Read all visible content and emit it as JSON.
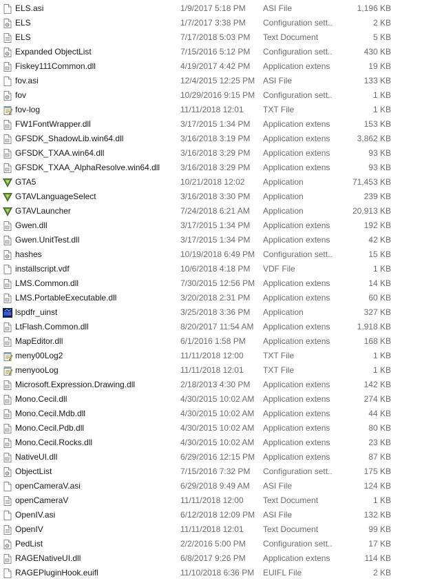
{
  "files": [
    {
      "name": "ELS.asi",
      "date": "1/9/2017 5:18 PM",
      "type": "ASI File",
      "size": "1,196 KB",
      "icon": "generic-file-icon"
    },
    {
      "name": "ELS",
      "date": "1/7/2017 3:38 PM",
      "type": "Configuration sett...",
      "size": "2 KB",
      "icon": "settings-file-icon"
    },
    {
      "name": "ELS",
      "date": "7/17/2018 5:03 PM",
      "type": "Text Document",
      "size": "5 KB",
      "icon": "text-file-icon"
    },
    {
      "name": "Expanded ObjectList",
      "date": "7/15/2016 5:12 PM",
      "type": "Configuration sett...",
      "size": "430 KB",
      "icon": "settings-file-icon"
    },
    {
      "name": "Fiskey111Common.dll",
      "date": "4/19/2017 4:42 PM",
      "type": "Application extens",
      "size": "19 KB",
      "icon": "dll-file-icon"
    },
    {
      "name": "fov.asi",
      "date": "12/4/2015 12:25 PM",
      "type": "ASI File",
      "size": "133 KB",
      "icon": "generic-file-icon"
    },
    {
      "name": "fov",
      "date": "10/29/2016 9:15 PM",
      "type": "Configuration sett...",
      "size": "1 KB",
      "icon": "settings-file-icon"
    },
    {
      "name": "fov-log",
      "date": "11/11/2018 12:01",
      "type": "TXT File",
      "size": "1 KB",
      "icon": "notepad-file-icon"
    },
    {
      "name": "FW1FontWrapper.dll",
      "date": "3/17/2015 1:34 PM",
      "type": "Application extens",
      "size": "153 KB",
      "icon": "dll-file-icon"
    },
    {
      "name": "GFSDK_ShadowLib.win64.dll",
      "date": "3/16/2018 3:19 PM",
      "type": "Application extens",
      "size": "3,862 KB",
      "icon": "dll-file-icon"
    },
    {
      "name": "GFSDK_TXAA.win64.dll",
      "date": "3/16/2018 3:29 PM",
      "type": "Application extens",
      "size": "93 KB",
      "icon": "dll-file-icon"
    },
    {
      "name": "GFSDK_TXAA_AlphaResolve.win64.dll",
      "date": "3/16/2018 3:29 PM",
      "type": "Application extens",
      "size": "93 KB",
      "icon": "dll-file-icon"
    },
    {
      "name": "GTA5",
      "date": "10/21/2018 12:02",
      "type": "Application",
      "size": "71,453 KB",
      "icon": "gta-v-icon"
    },
    {
      "name": "GTAVLanguageSelect",
      "date": "3/16/2018 3:30 PM",
      "type": "Application",
      "size": "239 KB",
      "icon": "gta-v-icon"
    },
    {
      "name": "GTAVLauncher",
      "date": "7/24/2018 6:21 AM",
      "type": "Application",
      "size": "20,913 KB",
      "icon": "gta-v-icon"
    },
    {
      "name": "Gwen.dll",
      "date": "3/17/2015 1:34 PM",
      "type": "Application extens",
      "size": "192 KB",
      "icon": "dll-file-icon"
    },
    {
      "name": "Gwen.UnitTest.dll",
      "date": "3/17/2015 1:34 PM",
      "type": "Application extens",
      "size": "42 KB",
      "icon": "dll-file-icon"
    },
    {
      "name": "hashes",
      "date": "10/19/2018 6:49 PM",
      "type": "Configuration sett...",
      "size": "15 KB",
      "icon": "settings-file-icon"
    },
    {
      "name": "installscript.vdf",
      "date": "10/6/2018 4:18 PM",
      "type": "VDF File",
      "size": "1 KB",
      "icon": "generic-file-icon"
    },
    {
      "name": "LMS.Common.dll",
      "date": "7/30/2015 12:56 PM",
      "type": "Application extens",
      "size": "14 KB",
      "icon": "dll-file-icon"
    },
    {
      "name": "LMS.PortableExecutable.dll",
      "date": "3/20/2018 2:31 PM",
      "type": "Application extens",
      "size": "60 KB",
      "icon": "dll-file-icon"
    },
    {
      "name": "lspdfr_uinst",
      "date": "3/25/2018 3:36 PM",
      "type": "Application",
      "size": "327 KB",
      "icon": "uninstaller-icon"
    },
    {
      "name": "LtFlash.Common.dll",
      "date": "8/20/2017 11:54 AM",
      "type": "Application extens",
      "size": "1,918 KB",
      "icon": "dll-file-icon"
    },
    {
      "name": "MapEditor.dll",
      "date": "6/1/2016 1:58 PM",
      "type": "Application extens",
      "size": "168 KB",
      "icon": "dll-file-icon"
    },
    {
      "name": "meny00Log2",
      "date": "11/11/2018 12:00",
      "type": "TXT File",
      "size": "1 KB",
      "icon": "notepad-file-icon"
    },
    {
      "name": "menyooLog",
      "date": "11/11/2018 12:01",
      "type": "TXT File",
      "size": "1 KB",
      "icon": "notepad-file-icon"
    },
    {
      "name": "Microsoft.Expression.Drawing.dll",
      "date": "2/18/2013 4:30 PM",
      "type": "Application extens",
      "size": "142 KB",
      "icon": "dll-file-icon"
    },
    {
      "name": "Mono.Cecil.dll",
      "date": "4/30/2015 10:02 AM",
      "type": "Application extens",
      "size": "274 KB",
      "icon": "dll-file-icon"
    },
    {
      "name": "Mono.Cecil.Mdb.dll",
      "date": "4/30/2015 10:02 AM",
      "type": "Application extens",
      "size": "44 KB",
      "icon": "dll-file-icon"
    },
    {
      "name": "Mono.Cecil.Pdb.dll",
      "date": "4/30/2015 10:02 AM",
      "type": "Application extens",
      "size": "80 KB",
      "icon": "dll-file-icon"
    },
    {
      "name": "Mono.Cecil.Rocks.dll",
      "date": "4/30/2015 10:02 AM",
      "type": "Application extens",
      "size": "23 KB",
      "icon": "dll-file-icon"
    },
    {
      "name": "NativeUI.dll",
      "date": "6/29/2016 12:15 PM",
      "type": "Application extens",
      "size": "87 KB",
      "icon": "dll-file-icon"
    },
    {
      "name": "ObjectList",
      "date": "7/15/2016 7:32 PM",
      "type": "Configuration sett...",
      "size": "175 KB",
      "icon": "settings-file-icon"
    },
    {
      "name": "openCameraV.asi",
      "date": "6/29/2018 9:49 AM",
      "type": "ASI File",
      "size": "124 KB",
      "icon": "generic-file-icon"
    },
    {
      "name": "openCameraV",
      "date": "11/11/2018 12:00",
      "type": "Text Document",
      "size": "1 KB",
      "icon": "text-file-icon"
    },
    {
      "name": "OpenIV.asi",
      "date": "6/12/2018 12:09 PM",
      "type": "ASI File",
      "size": "132 KB",
      "icon": "generic-file-icon"
    },
    {
      "name": "OpenIV",
      "date": "11/11/2018 12:01",
      "type": "Text Document",
      "size": "99 KB",
      "icon": "text-file-icon"
    },
    {
      "name": "PedList",
      "date": "2/2/2016 5:00 PM",
      "type": "Configuration sett...",
      "size": "17 KB",
      "icon": "settings-file-icon"
    },
    {
      "name": "RAGENativeUI.dll",
      "date": "6/8/2017 9:26 PM",
      "type": "Application extens",
      "size": "114 KB",
      "icon": "dll-file-icon"
    },
    {
      "name": "RAGEPluginHook.euifl",
      "date": "11/10/2018 6:36 PM",
      "type": "EUIFL File",
      "size": "2 KB",
      "icon": "generic-file-icon"
    }
  ]
}
